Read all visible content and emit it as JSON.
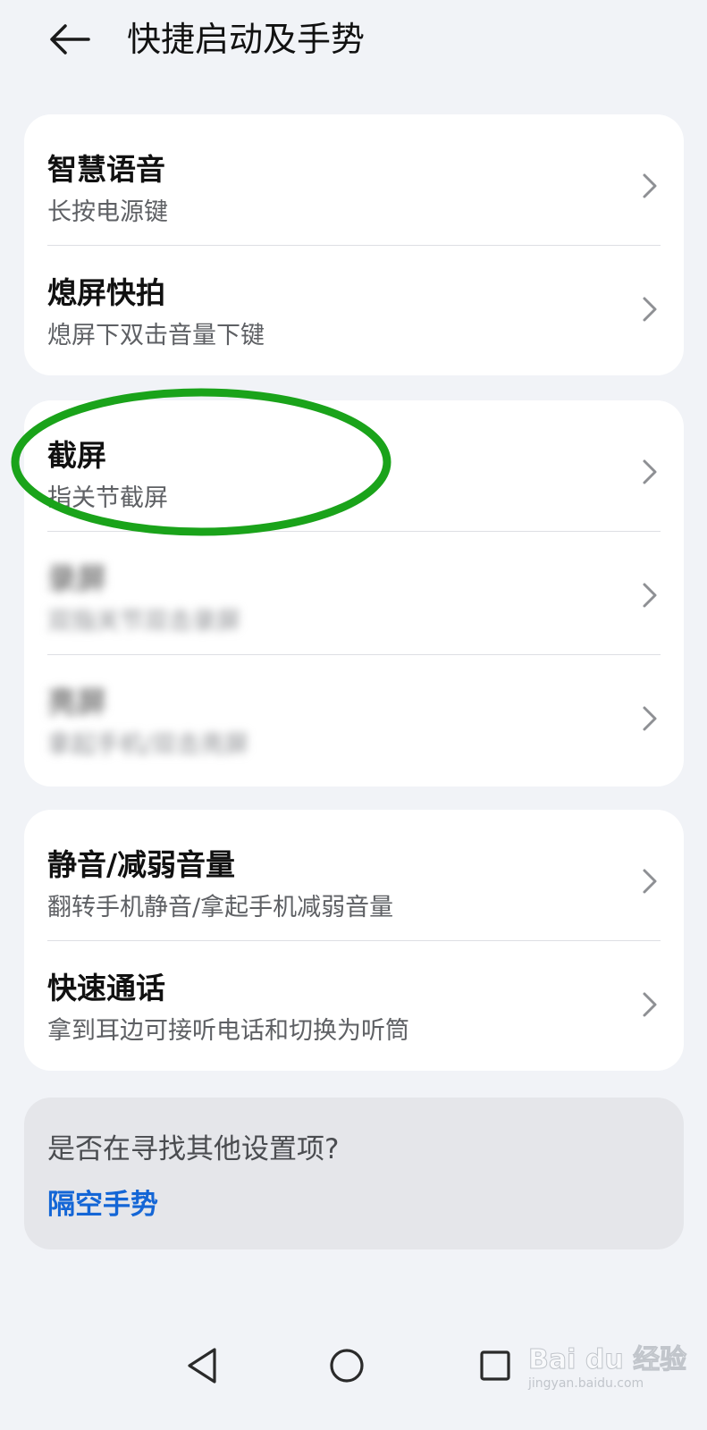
{
  "header": {
    "title": "快捷启动及手势",
    "back_icon": "arrow-left-icon"
  },
  "groups": [
    {
      "items": [
        {
          "title": "智慧语音",
          "subtitle": "长按电源键",
          "blurred": false
        },
        {
          "title": "熄屏快拍",
          "subtitle": "熄屏下双击音量下键",
          "blurred": false
        }
      ]
    },
    {
      "items": [
        {
          "title": "截屏",
          "subtitle": "指关节截屏",
          "blurred": false,
          "highlighted": true
        },
        {
          "title": "录屏",
          "subtitle": "双指关节双击录屏",
          "blurred": true
        },
        {
          "title": "亮屏",
          "subtitle": "拿起手机/双击亮屏",
          "blurred": true
        }
      ]
    },
    {
      "items": [
        {
          "title": "静音/减弱音量",
          "subtitle": "翻转手机静音/拿起手机减弱音量",
          "blurred": false
        },
        {
          "title": "快速通话",
          "subtitle": "拿到耳边可接听电话和切换为听筒",
          "blurred": false
        }
      ]
    }
  ],
  "find_more": {
    "question": "是否在寻找其他设置项?",
    "link": "隔空手势"
  },
  "navbar": {
    "back_icon": "triangle-back-icon",
    "home_icon": "circle-home-icon",
    "recents_icon": "square-recents-icon"
  },
  "watermark": {
    "brand": "Bai du 经验",
    "url": "jingyan.baidu.com"
  },
  "colors": {
    "background": "#f1f3f7",
    "card": "#ffffff",
    "link": "#1466d6",
    "highlight_ring": "#1aa31a"
  }
}
